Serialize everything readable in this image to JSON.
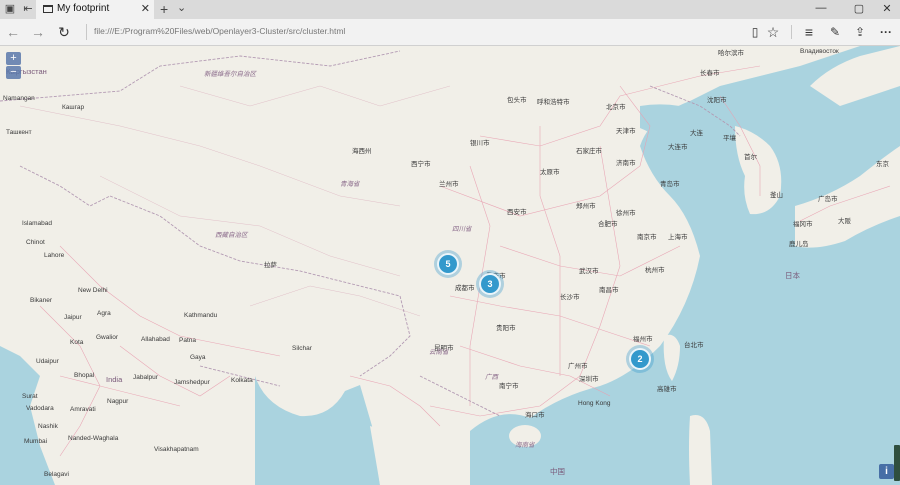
{
  "tab": {
    "title": "My footprint",
    "close": "✕",
    "new_tab": "+",
    "menu": "⌄"
  },
  "nav": {
    "back": "←",
    "forward": "→",
    "refresh": "↻",
    "url": "file:///E:/Program%20Files/web/Openlayer3-Cluster/src/cluster.html"
  },
  "toolbar": {
    "reading_view": "▯",
    "favorite": "☆",
    "hub": "≡",
    "notes": "✎",
    "share": "⇪",
    "more": "···"
  },
  "window": {
    "minimize": "—",
    "maximize": "▢",
    "close": "✕"
  },
  "map": {
    "zoom_in": "+",
    "zoom_out": "−",
    "info": "i",
    "clusters": [
      {
        "count": "5"
      },
      {
        "count": "3"
      },
      {
        "count": "2"
      }
    ],
    "labels": [
      "Владивосток",
      "Кыргызстан",
      "Namangan",
      "Ташкент",
      "Кашгар",
      "Chinot",
      "Islamabad",
      "Lahore",
      "Bikaner",
      "New Delhi",
      "Jaipur",
      "Agra",
      "Kathmandu",
      "Kota",
      "Gwalior",
      "Allahabad",
      "Patna",
      "Gaya",
      "Udaipur",
      "Bhopal",
      "India",
      "Jabalpur",
      "Jamshedpur",
      "Kolkata",
      "Silchar",
      "Surat",
      "Vadodara",
      "Amravati",
      "Nagpur",
      "Nashik",
      "Mumbai",
      "Nanded-Waghala",
      "Visakhapatnam",
      "Belagavi",
      "Hong Kong",
      "北京市",
      "天津市",
      "呼和浩特市",
      "包头市",
      "沈阳市",
      "长春市",
      "哈尔滨市",
      "大连市",
      "石家庄市",
      "太原市",
      "济南市",
      "青岛市",
      "银川市",
      "兰州市",
      "西宁市",
      "西安市",
      "郑州市",
      "徐州市",
      "南京市",
      "上海市",
      "合肥市",
      "武汉市",
      "杭州市",
      "长沙市",
      "南昌市",
      "福州市",
      "广州市",
      "深圳市",
      "南宁市",
      "海口市",
      "昆明市",
      "贵阳市",
      "重庆市",
      "成都市",
      "拉萨",
      "台北市",
      "高雄市",
      "首尔",
      "釜山",
      "平壤",
      "海西州",
      "青海省",
      "西藏自治区",
      "四川省",
      "云南省",
      "广西",
      "海南省",
      "中国",
      "日本",
      "鹿儿岛",
      "福冈市",
      "广岛市",
      "大阪",
      "东京",
      "新疆维吾尔自治区",
      "大连"
    ]
  }
}
